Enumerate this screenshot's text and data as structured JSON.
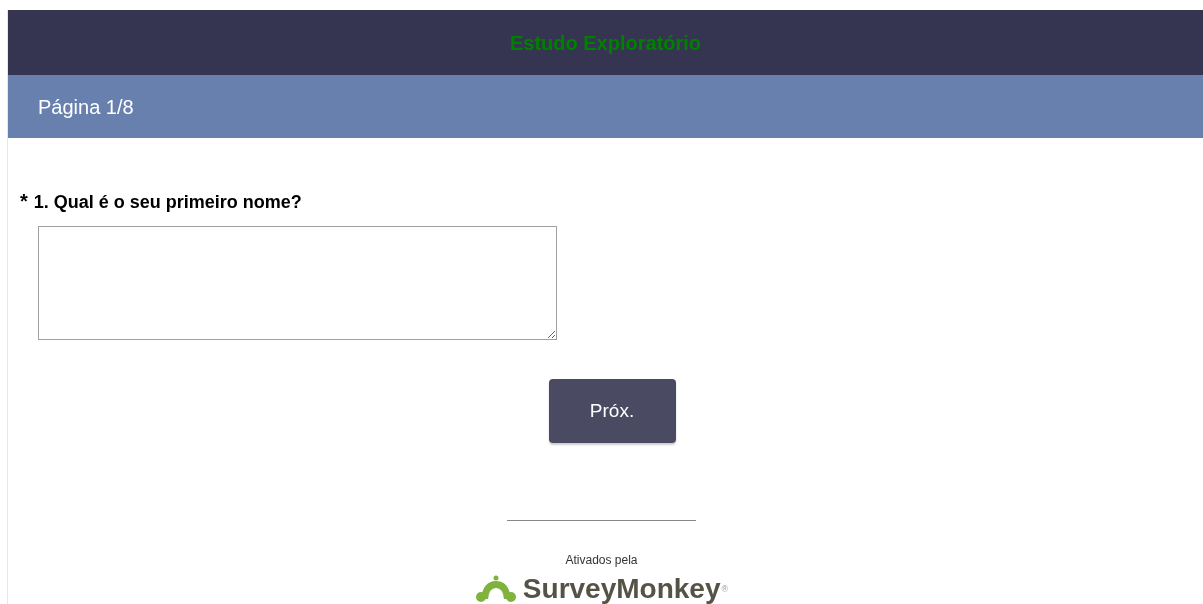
{
  "survey": {
    "title": "Estudo Exploratório"
  },
  "page": {
    "label": "Página 1/8"
  },
  "question": {
    "required_mark": "*",
    "text": "1. Qual é o seu primeiro nome?"
  },
  "next_button": "Próx.",
  "footer": {
    "powered_by": "Ativados pela",
    "brand": "SurveyMonkey",
    "registered": "®"
  }
}
